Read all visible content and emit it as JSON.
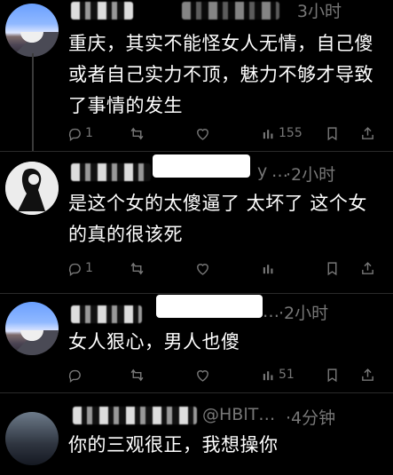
{
  "posts": [
    {
      "time": "3小时",
      "content": "重庆，其实不能怪女人无情，自己傻或者自己实力不顶，魅力不够才导致了事情的发生",
      "actions": {
        "reply_count": "1",
        "view_count": "155"
      }
    },
    {
      "handle": "…",
      "time": "·2小时",
      "handle_fragment": "y",
      "content": "是这个女的太傻逼了 太坏了 这个女的真的很该死",
      "actions": {
        "reply_count": "1"
      }
    },
    {
      "handle": "…",
      "time": "·2小时",
      "content": "女人狠心，男人也傻",
      "actions": {
        "view_count": "51"
      }
    },
    {
      "handle": "@HBlT…",
      "time": "·4分钟",
      "content": "你的三观很正，我想操你"
    }
  ],
  "icons": [
    "reply-icon",
    "retweet-icon",
    "like-icon",
    "views-icon",
    "bookmark-icon",
    "share-icon"
  ]
}
